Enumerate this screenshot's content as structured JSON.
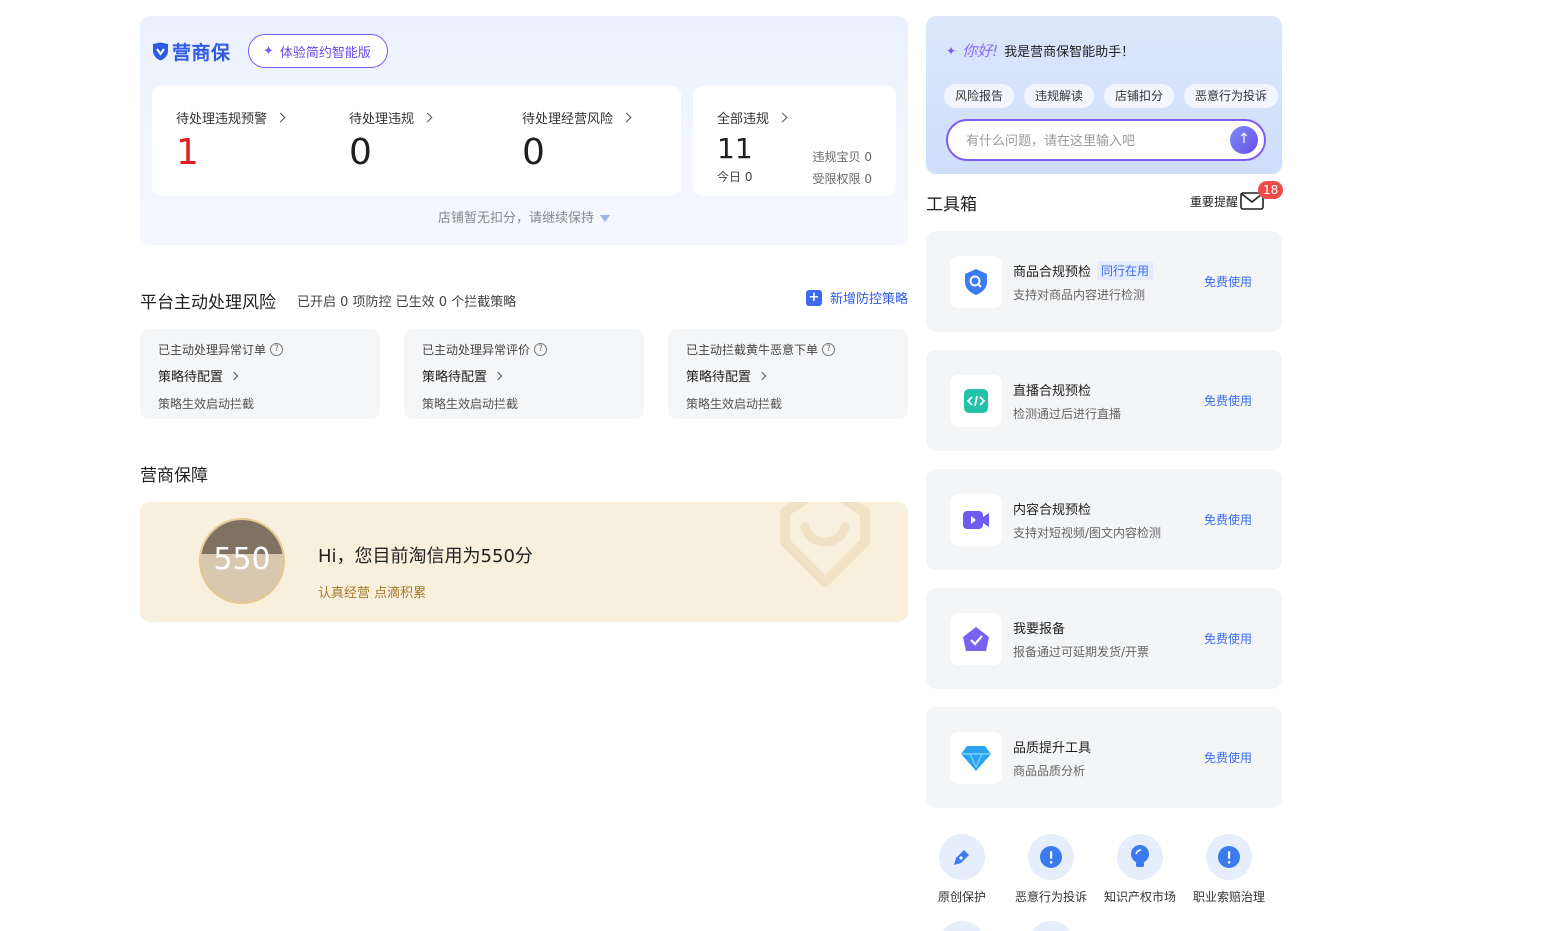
{
  "header": {
    "logo_text": "营商保",
    "experience_button": "体验简约智能版",
    "stats": [
      {
        "label": "待处理违规预警",
        "value": "1"
      },
      {
        "label": "待处理违规",
        "value": "0"
      },
      {
        "label": "待处理经营风险",
        "value": "0"
      }
    ],
    "all_violations": {
      "label": "全部违规",
      "value": "11",
      "today": "今日 0",
      "violation_items": "违规宝贝 0",
      "restricted": "受限权限 0"
    },
    "deduct_note": "店铺暂无扣分，请继续保持"
  },
  "risk": {
    "title": "平台主动处理风险",
    "summary": "已开启 0 项防控 已生效 0 个拦截策略",
    "add_button": "新增防控策略",
    "cards": [
      {
        "title": "已主动处理异常订单",
        "status": "策略待配置",
        "note": "策略生效启动拦截"
      },
      {
        "title": "已主动处理异常评价",
        "status": "策略待配置",
        "note": "策略生效启动拦截"
      },
      {
        "title": "已主动拦截黄牛恶意下单",
        "status": "策略待配置",
        "note": "策略生效启动拦截"
      }
    ]
  },
  "guarantee": {
    "title": "营商保障",
    "score": "550",
    "message": "Hi，您目前淘信用为550分",
    "sub": "认真经营 点滴积累"
  },
  "assistant": {
    "hello": "你好!",
    "greeting": "我是营商保智能助手！",
    "chips": [
      "风险报告",
      "违规解读",
      "店铺扣分",
      "恶意行为投诉"
    ],
    "input_placeholder": "有什么问题，请在这里输入吧"
  },
  "toolbox": {
    "title": "工具箱",
    "reminder": "重要提醒",
    "reminder_count": "18",
    "tools": [
      {
        "name": "商品合规预检",
        "tag": "同行在用",
        "desc": "支持对商品内容进行检测",
        "action": "免费使用",
        "icon": "shield-search-icon",
        "color": "#3b7bf0"
      },
      {
        "name": "直播合规预检",
        "tag": "",
        "desc": "检测通过后进行直播",
        "action": "免费使用",
        "icon": "code-icon",
        "color": "#23c1a6"
      },
      {
        "name": "内容合规预检",
        "tag": "",
        "desc": "支持对短视频/图文内容检测",
        "action": "免费使用",
        "icon": "video-icon",
        "color": "#6e5cf0"
      },
      {
        "name": "我要报备",
        "tag": "",
        "desc": "报备通过可延期发货/开票",
        "action": "免费使用",
        "icon": "house-check-icon",
        "color": "#7b62ee"
      },
      {
        "name": "品质提升工具",
        "tag": "",
        "desc": "商品品质分析",
        "action": "免费使用",
        "icon": "diamond-icon",
        "color": "#2aa3f0"
      }
    ],
    "quick_links": [
      {
        "label": "原创保护",
        "icon": "pen-icon"
      },
      {
        "label": "恶意行为投诉",
        "icon": "alert-icon"
      },
      {
        "label": "知识产权市场",
        "icon": "bulb-icon"
      },
      {
        "label": "职业索赔治理",
        "icon": "alert-icon"
      }
    ]
  },
  "colors": {
    "brand": "#2e5ae6",
    "accent_purple": "#7c5cf2",
    "alert_red": "#e02020",
    "guarantee_bg": "#f8efdd"
  }
}
